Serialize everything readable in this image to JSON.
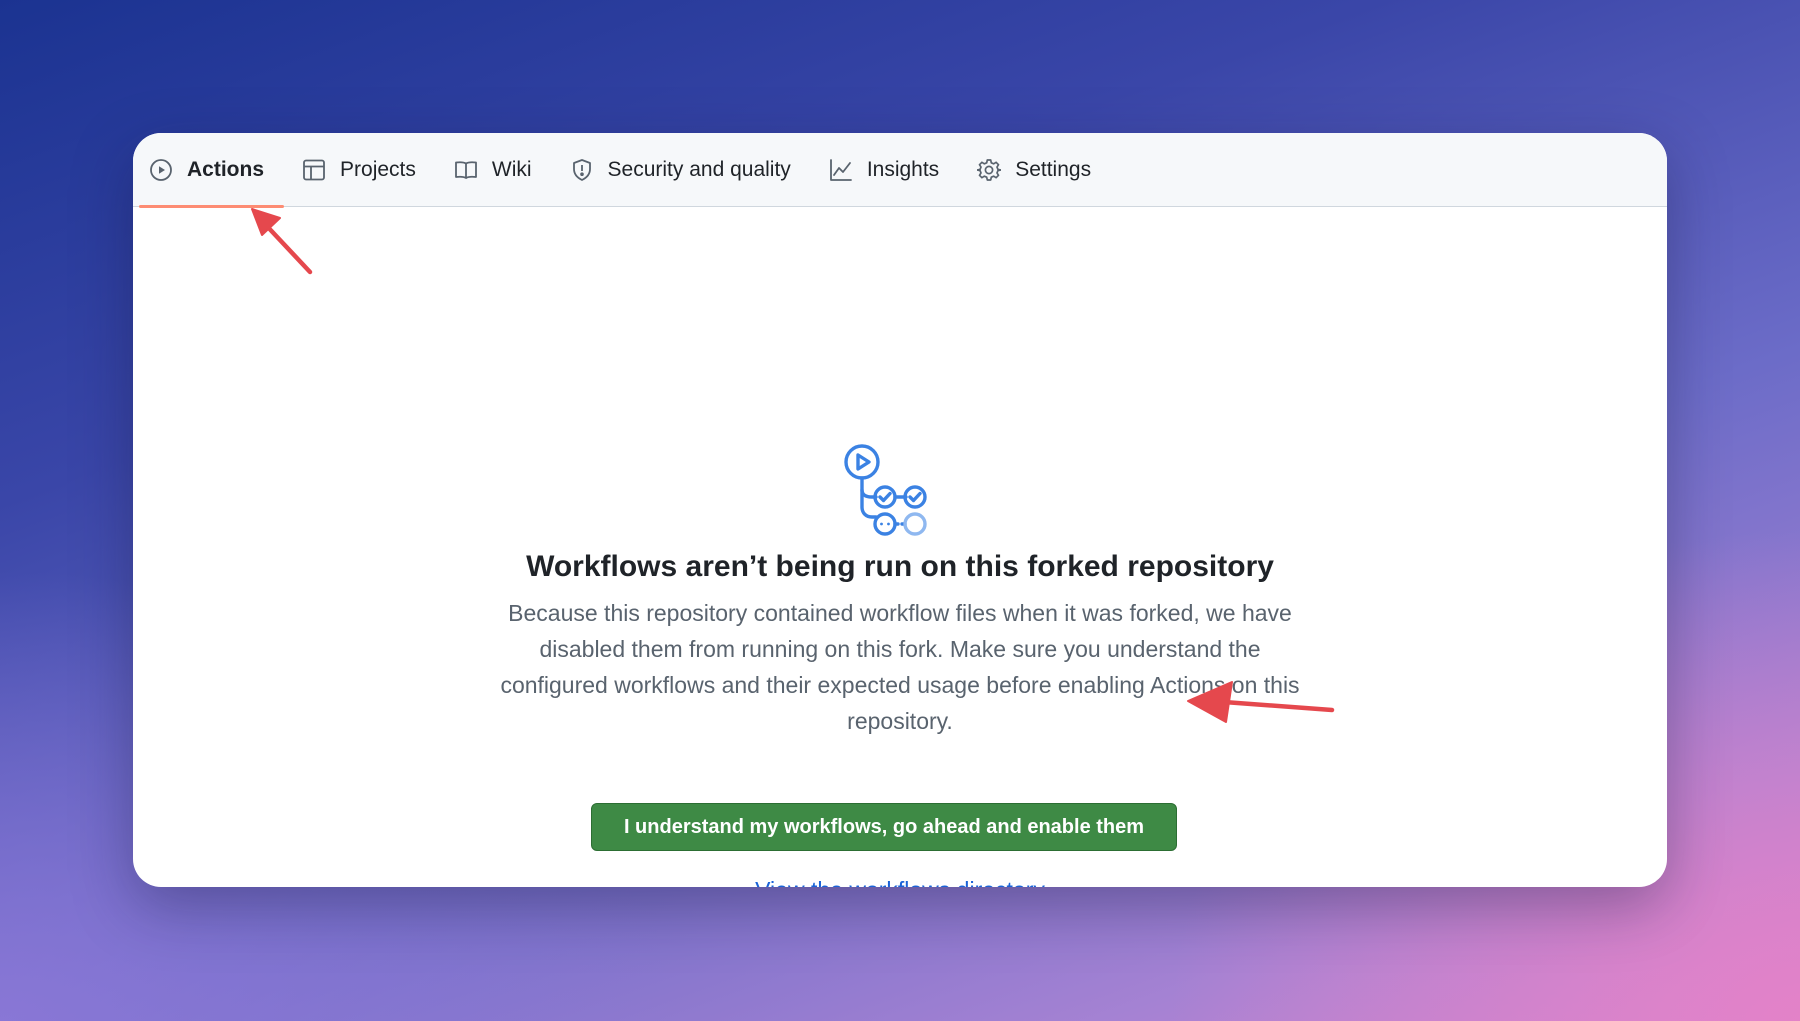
{
  "tabs": [
    {
      "label": "Actions",
      "icon": "play-icon",
      "selected": true
    },
    {
      "label": "Projects",
      "icon": "table-icon",
      "selected": false
    },
    {
      "label": "Wiki",
      "icon": "book-icon",
      "selected": false
    },
    {
      "label": "Security and quality",
      "icon": "shield-icon",
      "selected": false
    },
    {
      "label": "Insights",
      "icon": "graph-icon",
      "selected": false
    },
    {
      "label": "Settings",
      "icon": "gear-icon",
      "selected": false
    }
  ],
  "main": {
    "icon": "workflow-icon",
    "heading": "Workflows aren’t being run on this forked repository",
    "description": "Because this repository contained workflow files when it was forked, we have disabled them from running on this fork. Make sure you understand the configured workflows and their expected usage before enabling Actions on this repository.",
    "enable_button_label": "I understand my workflows, go ahead and enable them",
    "workflows_link_label": "View the workflows directory"
  },
  "colors": {
    "accent_blue": "#1a63d8",
    "button_green": "#3e8a45",
    "selected_underline": "#fd8c73",
    "annotation_arrow": "#e5484d"
  }
}
